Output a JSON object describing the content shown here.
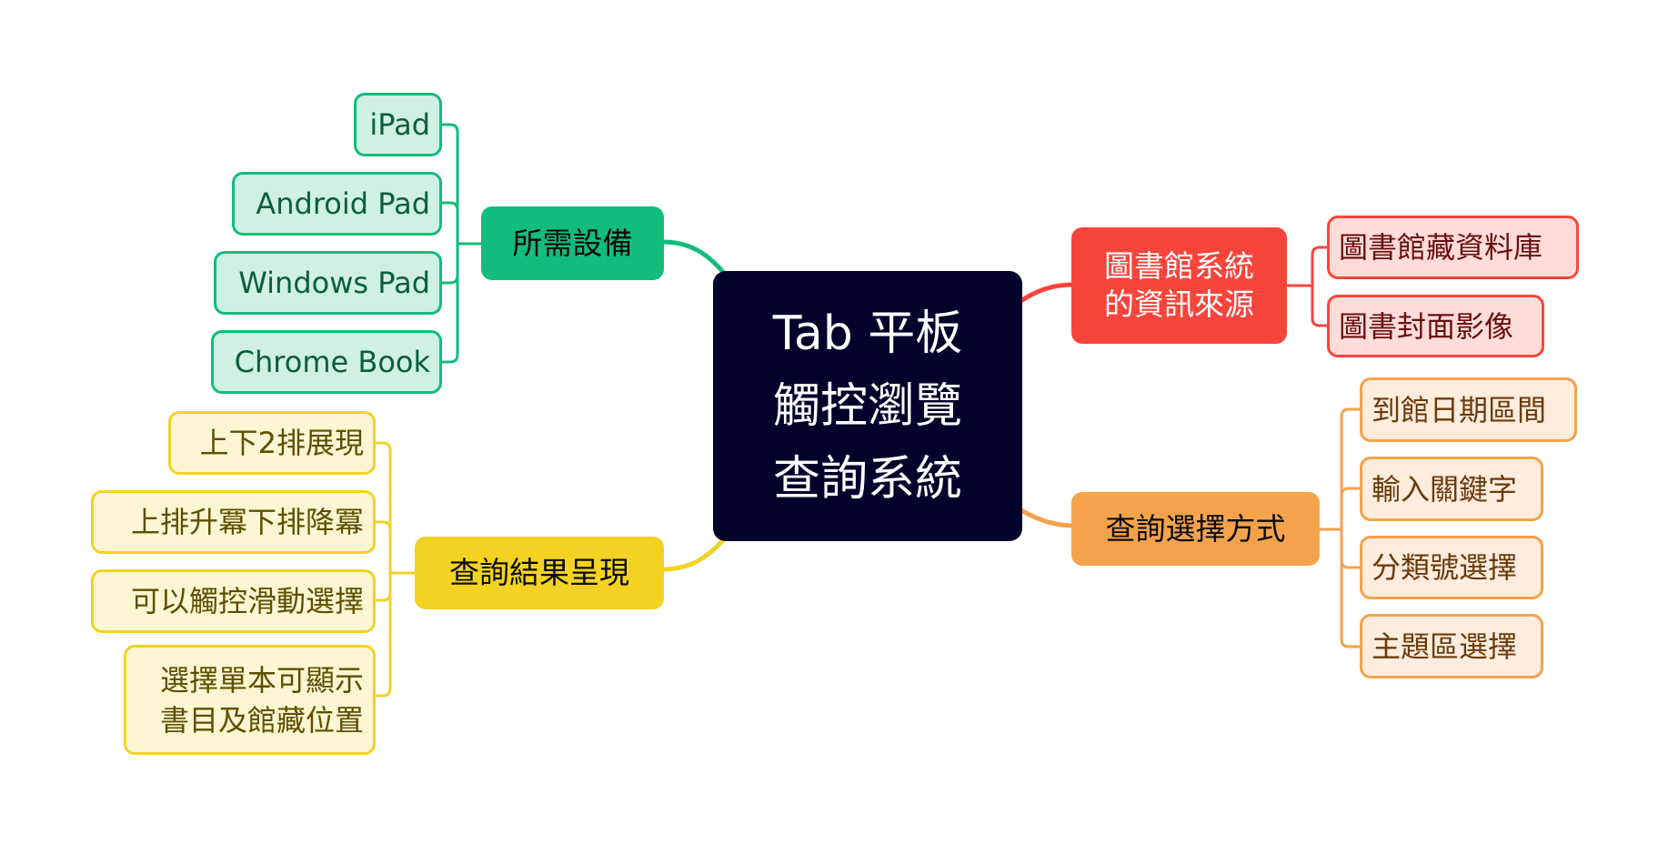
{
  "central": {
    "label": "Tab 平板\n觸控瀏覽\n查詢系統",
    "color": "#03022b"
  },
  "branches": [
    {
      "id": "devices",
      "label": "所需設備",
      "color": "#12bc7c",
      "children": [
        "iPad",
        "Android Pad",
        "Windows Pad",
        "Chrome Book"
      ]
    },
    {
      "id": "results",
      "label": "查詢結果呈現",
      "color": "#f2d323",
      "children": [
        "上下2排展現",
        "上排升冪下排降冪",
        "可以觸控滑動選擇",
        "選擇單本可顯示\n書目及館藏位置"
      ]
    },
    {
      "id": "sources",
      "label": "圖書館系統\n的資訊來源",
      "color": "#f8453c",
      "children": [
        "圖書館藏資料庫",
        "圖書封面影像"
      ]
    },
    {
      "id": "query",
      "label": "查詢選擇方式",
      "color": "#f5a24c",
      "children": [
        "到館日期區間",
        "輸入關鍵字",
        "分類號選擇",
        "主題區選擇"
      ]
    }
  ]
}
